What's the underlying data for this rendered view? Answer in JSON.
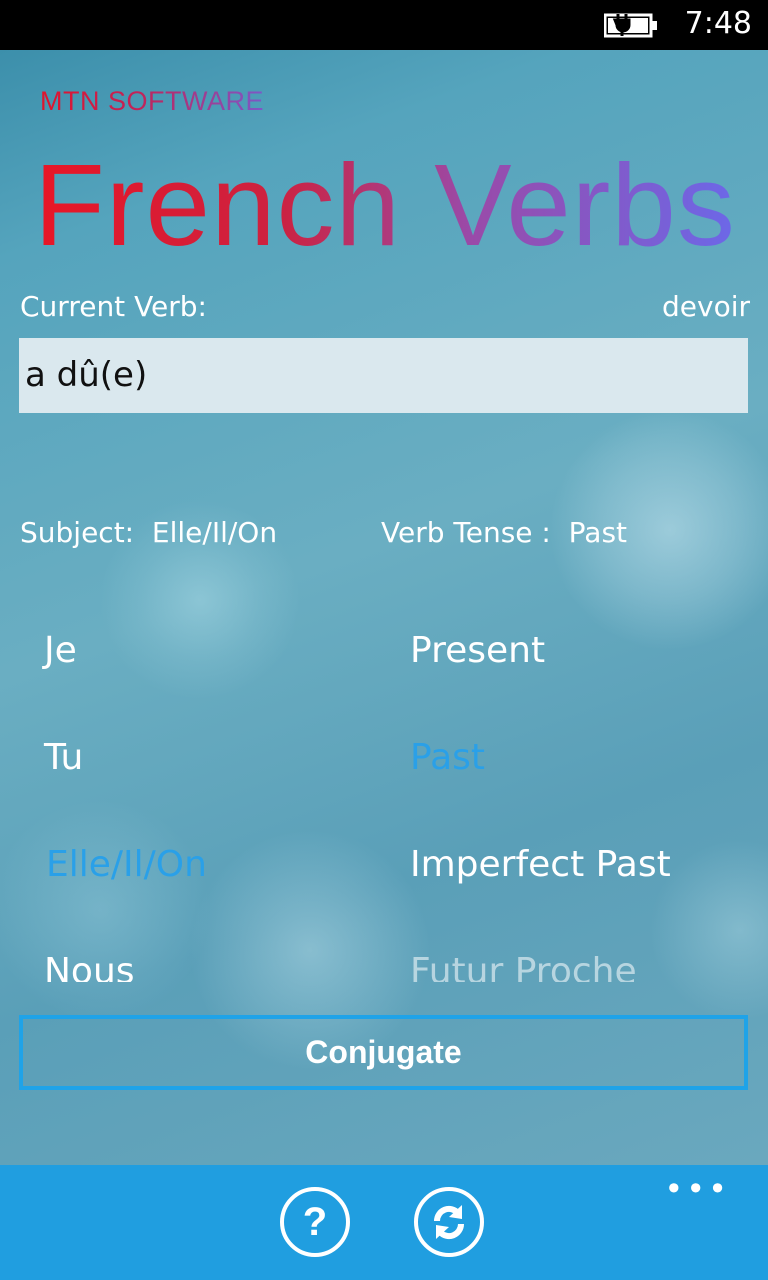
{
  "status": {
    "time": "7:48"
  },
  "app": {
    "brand": "MTN SOFTWARE",
    "title": "French Verbs",
    "current_verb_label": "Current Verb:",
    "current_verb": "devoir",
    "conjugation": "a dû(e)",
    "subject_label": "Subject:",
    "subject_value": "Elle/Il/On",
    "tense_label": "Verb Tense :",
    "tense_value": "Past"
  },
  "subjects": [
    "Je",
    "Tu",
    "Elle/Il/On",
    "Nous"
  ],
  "selected_subject": "Elle/Il/On",
  "tenses": [
    "Present",
    "Past",
    "Imperfect Past",
    "Futur Proche"
  ],
  "selected_tense": "Past",
  "conjugate_button": "Conjugate",
  "app_bar": {
    "buttons": [
      {
        "icon": "help-icon"
      },
      {
        "icon": "refresh-icon"
      }
    ],
    "more": "•••"
  },
  "colors": {
    "accent": "#209ee0",
    "selected": "#2aa0e8",
    "title_start": "#e81626",
    "title_end": "#6c68e8"
  }
}
